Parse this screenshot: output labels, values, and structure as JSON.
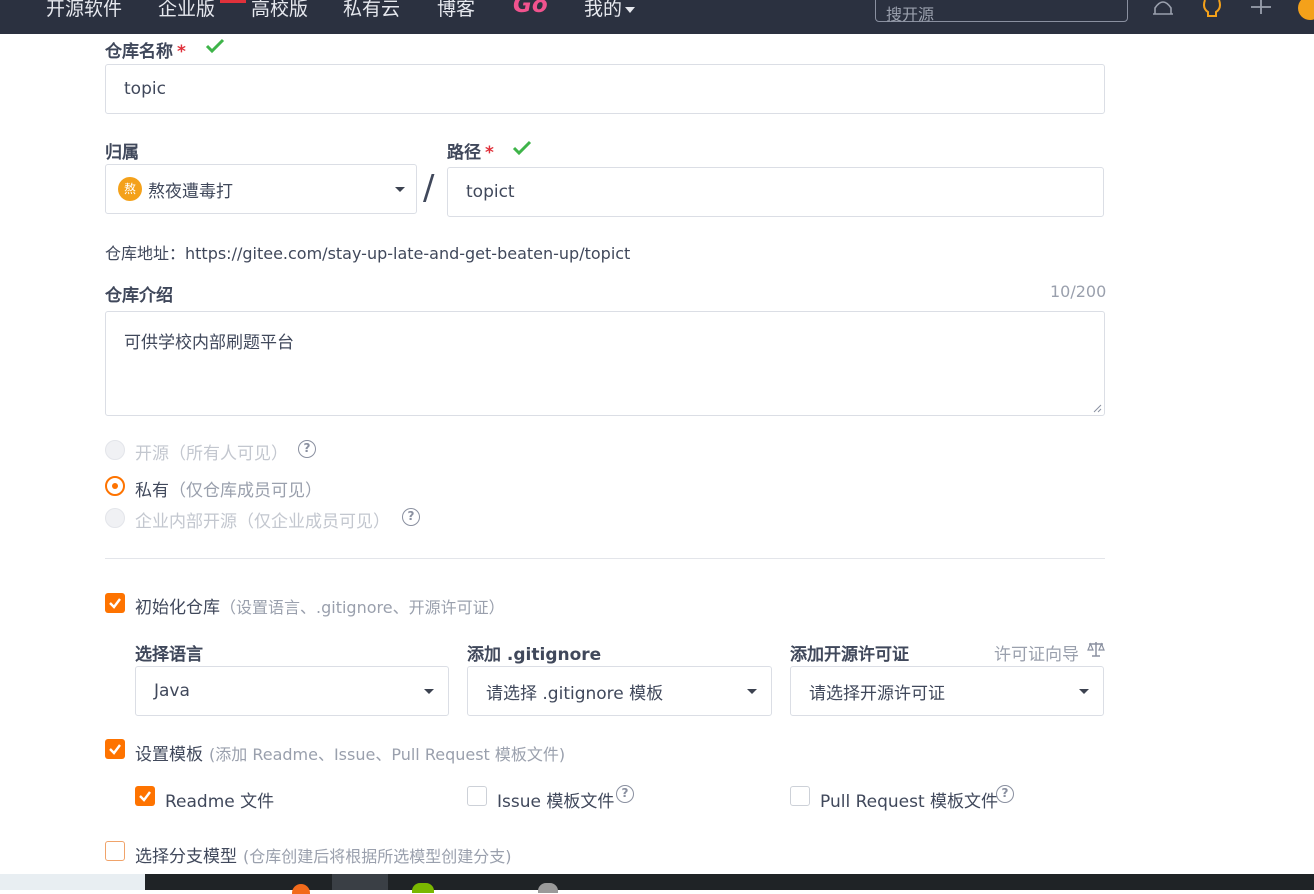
{
  "nav": {
    "items": [
      "开源软件",
      "企业版",
      "高校版",
      "私有云",
      "博客"
    ],
    "go_label": "Go",
    "mine_label": "我的",
    "search_placeholder": "搜开源"
  },
  "form": {
    "repo_name": {
      "label": "仓库名称",
      "required": "*",
      "value": "topic"
    },
    "owner": {
      "label": "归属",
      "avatar_char": "熬",
      "value": "熬夜遭毒打"
    },
    "separator": "/",
    "path": {
      "label": "路径",
      "required": "*",
      "value": "topict"
    },
    "repo_address": "仓库地址：https://gitee.com/stay-up-late-and-get-beaten-up/topict",
    "intro": {
      "label": "仓库介绍",
      "counter": "10/200",
      "value": "可供学校内部刷题平台"
    },
    "visibility": [
      {
        "label": "开源",
        "hint": "（所有人可见）",
        "selected": false,
        "disabled": true
      },
      {
        "label": "私有",
        "hint": "（仅仓库成员可见）",
        "selected": true,
        "disabled": false
      },
      {
        "label": "企业内部开源",
        "hint": "（仅企业成员可见）",
        "selected": false,
        "disabled": true
      }
    ],
    "init_repo": {
      "label": "初始化仓库",
      "hint": "（设置语言、.gitignore、开源许可证）",
      "checked": true
    },
    "language": {
      "label": "选择语言",
      "value": "Java"
    },
    "gitignore": {
      "label": "添加 .gitignore",
      "value": "请选择 .gitignore 模板"
    },
    "license": {
      "label": "添加开源许可证",
      "guide": "许可证向导",
      "value": "请选择开源许可证"
    },
    "templates": {
      "label": "设置模板",
      "hint": "(添加 Readme、Issue、Pull Request 模板文件)",
      "checked": true
    },
    "readme": {
      "label": "Readme 文件",
      "checked": true
    },
    "issue_tpl": {
      "label": "Issue 模板文件",
      "checked": false
    },
    "pr_tpl": {
      "label": "Pull Request 模板文件",
      "checked": false
    },
    "branch_model": {
      "label": "选择分支模型",
      "hint": "(仓库创建后将根据所选模型创建分支)",
      "checked": false
    }
  },
  "colors": {
    "accent": "#fe7300",
    "check_green": "#3eb449",
    "nav_bg": "#2b3140",
    "required_red": "#e0313b"
  }
}
